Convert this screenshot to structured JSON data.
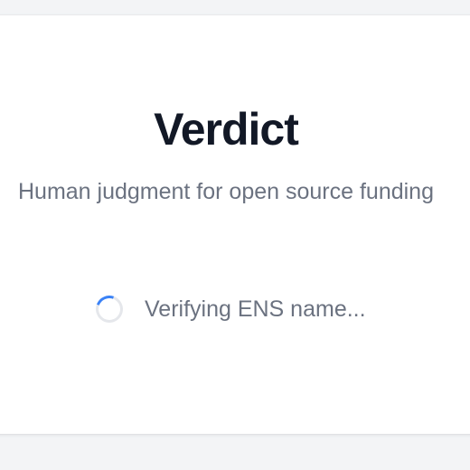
{
  "app": {
    "title": "Verdict",
    "tagline": "Human judgment for open source funding"
  },
  "status": {
    "message": "Verifying ENS name...",
    "spinner_icon": "loading-spinner-icon"
  },
  "colors": {
    "accent": "#3b82f6",
    "title": "#121826",
    "muted_text": "#6b7280",
    "background": "#f3f4f6",
    "card": "#ffffff"
  }
}
